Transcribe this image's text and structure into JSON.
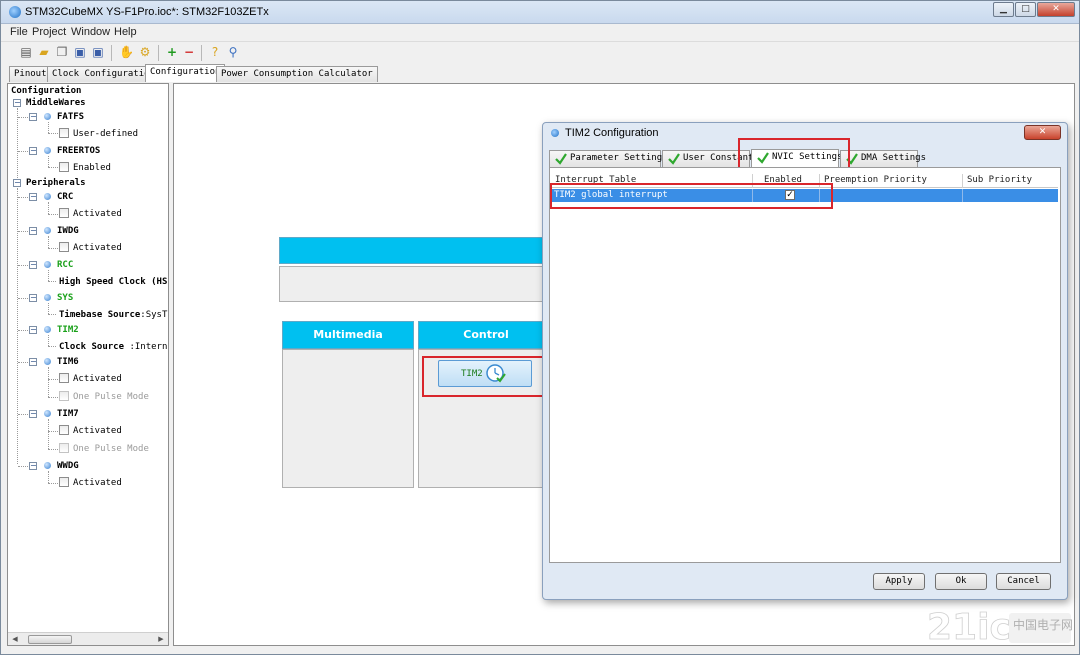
{
  "window": {
    "title": "STM32CubeMX YS-F1Pro.ioc*: STM32F103ZETx",
    "controls": {
      "minimize": "▁",
      "maximize": "□",
      "close": "✕"
    }
  },
  "menu": [
    "File",
    "Project",
    "Window",
    "Help"
  ],
  "toolbar_icons": [
    "new-project-icon",
    "open-icon",
    "copy-icon",
    "save-icon",
    "save-as-icon",
    "hand-icon",
    "generate-code-icon",
    "add-icon",
    "remove-icon",
    "help-icon",
    "search-icon"
  ],
  "main_tabs": [
    "Pinout",
    "Clock Configuration",
    "Configuration",
    "Power Consumption Calculator"
  ],
  "active_main_tab": "Configuration",
  "tree": {
    "root": "Configuration",
    "middlewares": {
      "label": "MiddleWares",
      "items": [
        {
          "name": "FATFS",
          "option": "User-defined"
        },
        {
          "name": "FREERTOS",
          "option": "Enabled"
        }
      ]
    },
    "peripherals": {
      "label": "Peripherals",
      "crc": {
        "name": "CRC",
        "option": "Activated"
      },
      "iwdg": {
        "name": "IWDG",
        "option": "Activated"
      },
      "rcc": {
        "name": "RCC",
        "text": "High Speed Clock (HS"
      },
      "sys": {
        "name": "SYS",
        "text_bold": "Timebase Source",
        "text_value": ":SysTi"
      },
      "tim2": {
        "name": "TIM2",
        "text_bold": "Clock Source ",
        "text_value": ":Interna"
      },
      "tim6": {
        "name": "TIM6",
        "option1": "Activated",
        "option2": "One Pulse Mode"
      },
      "tim7": {
        "name": "TIM7",
        "option1": "Activated",
        "option2": "One Pulse Mode"
      },
      "wwdg": {
        "name": "WWDG",
        "option": "Activated"
      }
    }
  },
  "scroll_arrows": {
    "left": "◀",
    "right": "▶"
  },
  "config_area": {
    "sections": [
      "Multimedia",
      "Control"
    ],
    "tim2_button": "TIM2"
  },
  "dialog": {
    "title": "TIM2 Configuration",
    "close_glyph": "✕",
    "tabs": [
      "Parameter Settings",
      "User Constants",
      "NVIC Settings",
      "DMA Settings"
    ],
    "active_tab": "NVIC Settings",
    "table": {
      "columns": [
        "Interrupt Table",
        "Enabled",
        "Preemption Priority",
        "Sub Priority"
      ],
      "rows": [
        {
          "name": "TIM2 global interrupt",
          "enabled": "✓",
          "preemption": "",
          "sub": ""
        }
      ]
    },
    "buttons": {
      "apply": "Apply",
      "ok": "Ok",
      "cancel": "Cancel"
    }
  },
  "colors": {
    "accent_cyan": "#00c0f0",
    "selection_blue": "#3a8ee6",
    "highlight_red": "#d9262c",
    "active_green": "#19a019"
  }
}
